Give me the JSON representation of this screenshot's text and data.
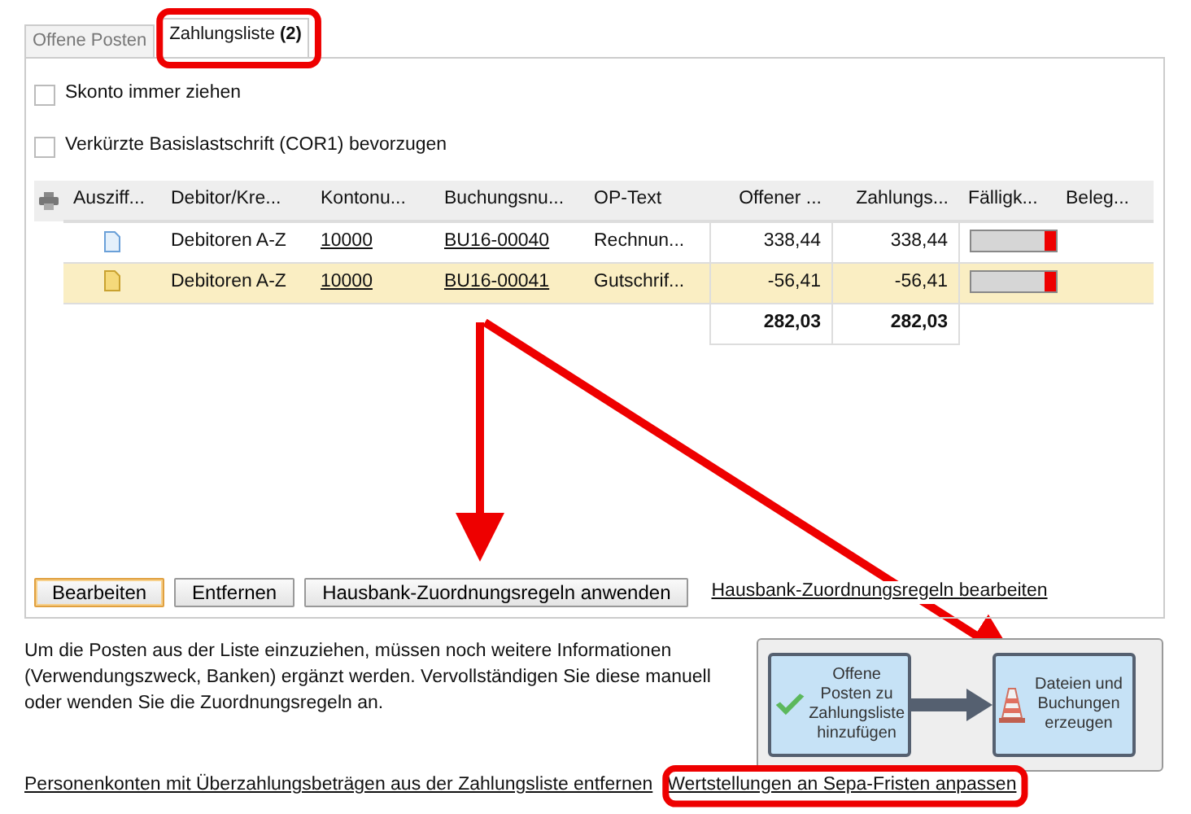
{
  "tabs": [
    {
      "label": "Offene Posten",
      "selected": false
    },
    {
      "label": "Zahlungsliste",
      "count": "(2)",
      "selected": true
    }
  ],
  "options": [
    {
      "label": "Skonto immer ziehen",
      "checked": false
    },
    {
      "label": "Verkürzte Basislastschrift (COR1) bevorzugen",
      "checked": false
    }
  ],
  "table": {
    "columns": [
      "Ausziff...",
      "Debitor/Kre...",
      "Kontonu...",
      "Buchungsnu...",
      "OP-Text",
      "Offener ...",
      "Zahlungs...",
      "Fälligk...",
      "Beleg..."
    ],
    "rows": [
      {
        "selected": false,
        "debitor": "Debitoren A-Z",
        "konto": "10000",
        "buchung": "BU16-00040",
        "text": "Rechnun...",
        "offen": "338,44",
        "zahlung": "338,44"
      },
      {
        "selected": true,
        "debitor": "Debitoren A-Z",
        "konto": "10000",
        "buchung": "BU16-00041",
        "text": "Gutschrif...",
        "offen": "-56,41",
        "zahlung": "-56,41"
      }
    ],
    "totals": {
      "offen": "282,03",
      "zahlung": "282,03"
    }
  },
  "buttons": [
    {
      "label": "Bearbeiten",
      "kind": "default"
    },
    {
      "label": "Entfernen",
      "kind": "normal"
    },
    {
      "label": "Hausbank-Zuordnungsregeln anwenden",
      "kind": "normal"
    },
    {
      "label": "Hausbank-Zuordnungsregeln bearbeiten",
      "kind": "link"
    }
  ],
  "info": "Um die Posten aus der Liste einzuziehen, müssen noch weitere Informationen (Verwendungszweck, Banken) ergänzt werden. Vervollständigen Sie diese manuell oder wenden Sie die Zuordnungsregeln an.",
  "steps": [
    {
      "label": "Offene Posten zu Zahlungsliste hinzufügen",
      "kind": "done"
    },
    {
      "label": "Dateien und Buchungen erzeugen",
      "kind": "pending"
    }
  ],
  "links": [
    "Personenkonten mit Überzahlungsbeträgen aus der Zahlungsliste entfernen",
    "Wertstellungen an Sepa-Fristen anpassen"
  ]
}
